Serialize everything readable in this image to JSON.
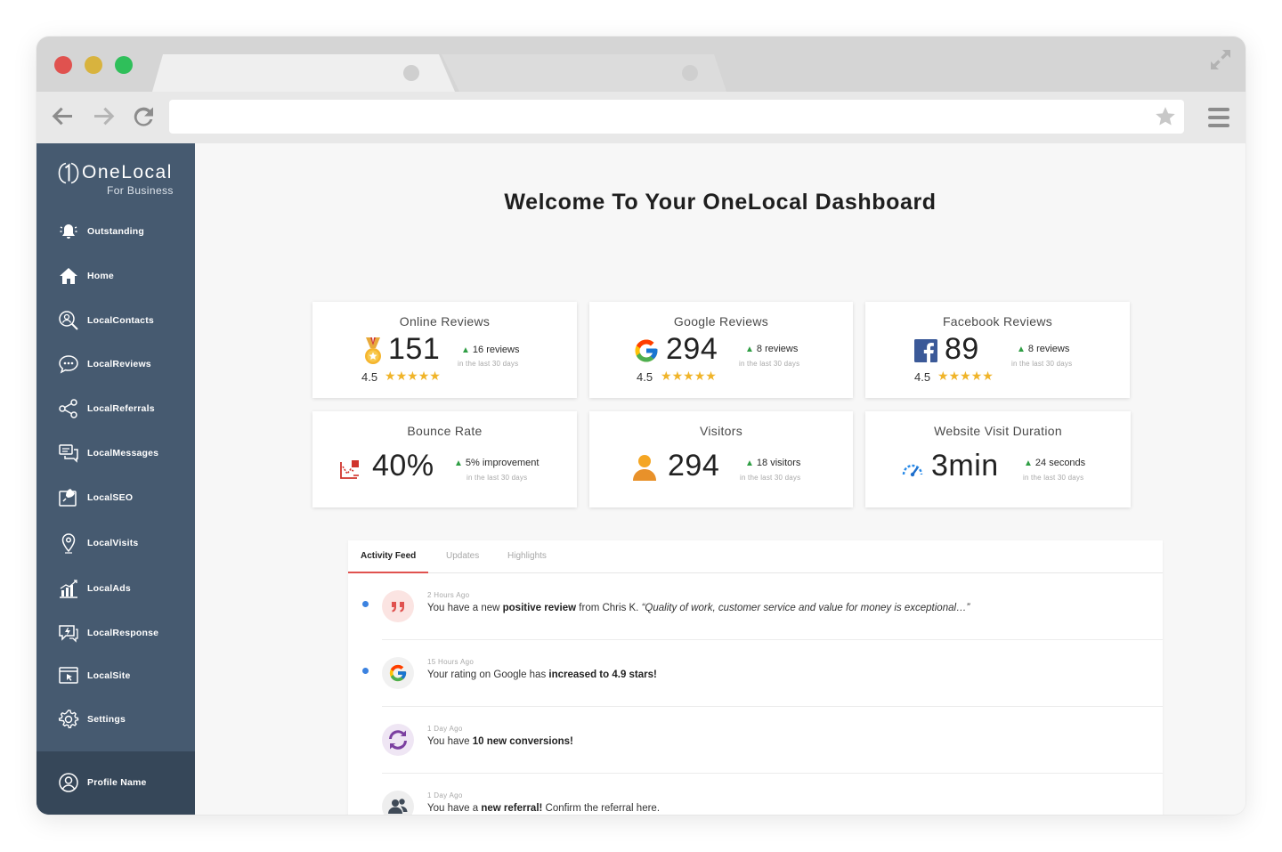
{
  "browser": {
    "url": ""
  },
  "sidebar": {
    "brand": {
      "name_part1": "One",
      "name_part2": "Local",
      "tagline": "For Business"
    },
    "items": [
      {
        "label": "Outstanding",
        "icon": "alarm-bell-icon"
      },
      {
        "label": "Home",
        "icon": "home-icon"
      },
      {
        "label": "LocalContacts",
        "icon": "contacts-search-icon"
      },
      {
        "label": "LocalReviews",
        "icon": "chat-bubble-icon"
      },
      {
        "label": "LocalReferrals",
        "icon": "share-network-icon"
      },
      {
        "label": "LocalMessages",
        "icon": "messages-icon"
      },
      {
        "label": "LocalSEO",
        "icon": "seo-rocket-icon"
      },
      {
        "label": "LocalVisits",
        "icon": "location-pin-icon"
      },
      {
        "label": "LocalAds",
        "icon": "ads-chart-icon"
      },
      {
        "label": "LocalResponse",
        "icon": "response-bolt-icon"
      },
      {
        "label": "LocalSite",
        "icon": "website-cursor-icon"
      },
      {
        "label": "Settings",
        "icon": "gear-icon"
      }
    ],
    "profile": {
      "label": "Profile Name",
      "icon": "user-circle-icon"
    }
  },
  "main": {
    "title": "Welcome To Your OneLocal Dashboard",
    "cards": [
      {
        "title": "Online Reviews",
        "value": "151",
        "delta": "16 reviews",
        "period": "in the last 30 days",
        "rating": "4.5",
        "stars": 4.5,
        "icon": "medal-icon"
      },
      {
        "title": "Google Reviews",
        "value": "294",
        "delta": "8 reviews",
        "period": "in the last 30 days",
        "rating": "4.5",
        "stars": 4.5,
        "icon": "google-icon"
      },
      {
        "title": "Facebook Reviews",
        "value": "89",
        "delta": "8 reviews",
        "period": "in the last 30 days",
        "rating": "4.5",
        "stars": 4.5,
        "icon": "facebook-icon"
      },
      {
        "title": "Bounce Rate",
        "value": "40%",
        "delta": "5% improvement",
        "period": "in the last 30 days",
        "icon": "bounce-chart-icon"
      },
      {
        "title": "Visitors",
        "value": "294",
        "delta": "18 visitors",
        "period": "in the last 30 days",
        "icon": "person-icon"
      },
      {
        "title": "Website Visit Duration",
        "value": "3min",
        "delta": "24 seconds",
        "period": "in the last 30 days",
        "icon": "speedometer-icon"
      }
    ],
    "feed": {
      "tabs": [
        "Activity Feed",
        "Updates",
        "Highlights"
      ],
      "active_tab": "Activity Feed",
      "items": [
        {
          "time": "2 Hours Ago",
          "pre": "You have a new ",
          "bold": "positive review",
          "post": " from Chris K. ",
          "quote": "“Quality of work, customer service and value for money is exceptional…”",
          "unread": true,
          "icon": "quote-icon",
          "icon_color": "#e0524f"
        },
        {
          "time": "15 Hours Ago",
          "pre": "Your rating on Google has ",
          "bold": "increased to 4.9 stars!",
          "post": "",
          "quote": "",
          "unread": true,
          "icon": "google-icon",
          "icon_color": "#4285f4"
        },
        {
          "time": "1 Day Ago",
          "pre": "You have ",
          "bold": "10 new conversions!",
          "post": "",
          "quote": "",
          "unread": false,
          "icon": "conversion-arrows-icon",
          "icon_color": "#7b3fa0"
        },
        {
          "time": "1 Day Ago",
          "pre": "You have a ",
          "bold": "new referral!",
          "post": " Confirm the referral here.",
          "quote": "",
          "unread": false,
          "icon": "referral-users-icon",
          "icon_color": "#3f4a57"
        }
      ]
    }
  },
  "colors": {
    "sidebar": "#465a70",
    "sidebar_profile": "#364759",
    "accent_red": "#e0524f",
    "positive_green": "#2f9e44",
    "star_gold": "#f0b429",
    "unread_blue": "#3b82e0"
  }
}
